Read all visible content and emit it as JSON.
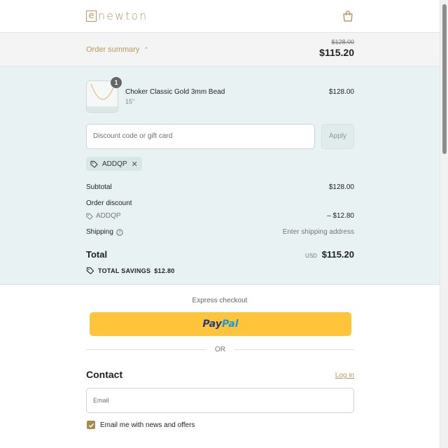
{
  "brand": {
    "logo_letter": "e",
    "logo_text": "newton"
  },
  "summary_bar": {
    "toggle_label": "Order summary",
    "original_price": "$128.00",
    "total_price": "$115.20"
  },
  "product": {
    "quantity": "1",
    "name": "Choker Classic Gold 3mm Bead",
    "variant": "15\"",
    "price": "$128.00"
  },
  "discount": {
    "placeholder": "Discount code or gift card",
    "apply_label": "Apply",
    "applied_code": "ADDQP"
  },
  "totals": {
    "subtotal_label": "Subtotal",
    "subtotal_value": "$128.00",
    "order_discount_label": "Order discount",
    "discount_code": "ADDQP",
    "discount_value": "– $12.80",
    "shipping_label": "Shipping",
    "shipping_value": "Enter shipping address",
    "total_label": "Total",
    "currency": "USD",
    "total_value": "$115.20",
    "savings_label": "TOTAL SAVINGS",
    "savings_value": "$12.80"
  },
  "express": {
    "title": "Express checkout",
    "paypal_part1": "Pay",
    "paypal_part2": "Pal",
    "or_label": "OR"
  },
  "contact": {
    "title": "Contact",
    "login_label": "Log in",
    "email_placeholder": "Email",
    "newsletter_label": "Email me with news and offers",
    "newsletter_checked": true
  },
  "colors": {
    "accent_gold": "#b89a5e",
    "summary_bg": "#e9f2f2",
    "paypal_yellow": "#ffc43a"
  }
}
